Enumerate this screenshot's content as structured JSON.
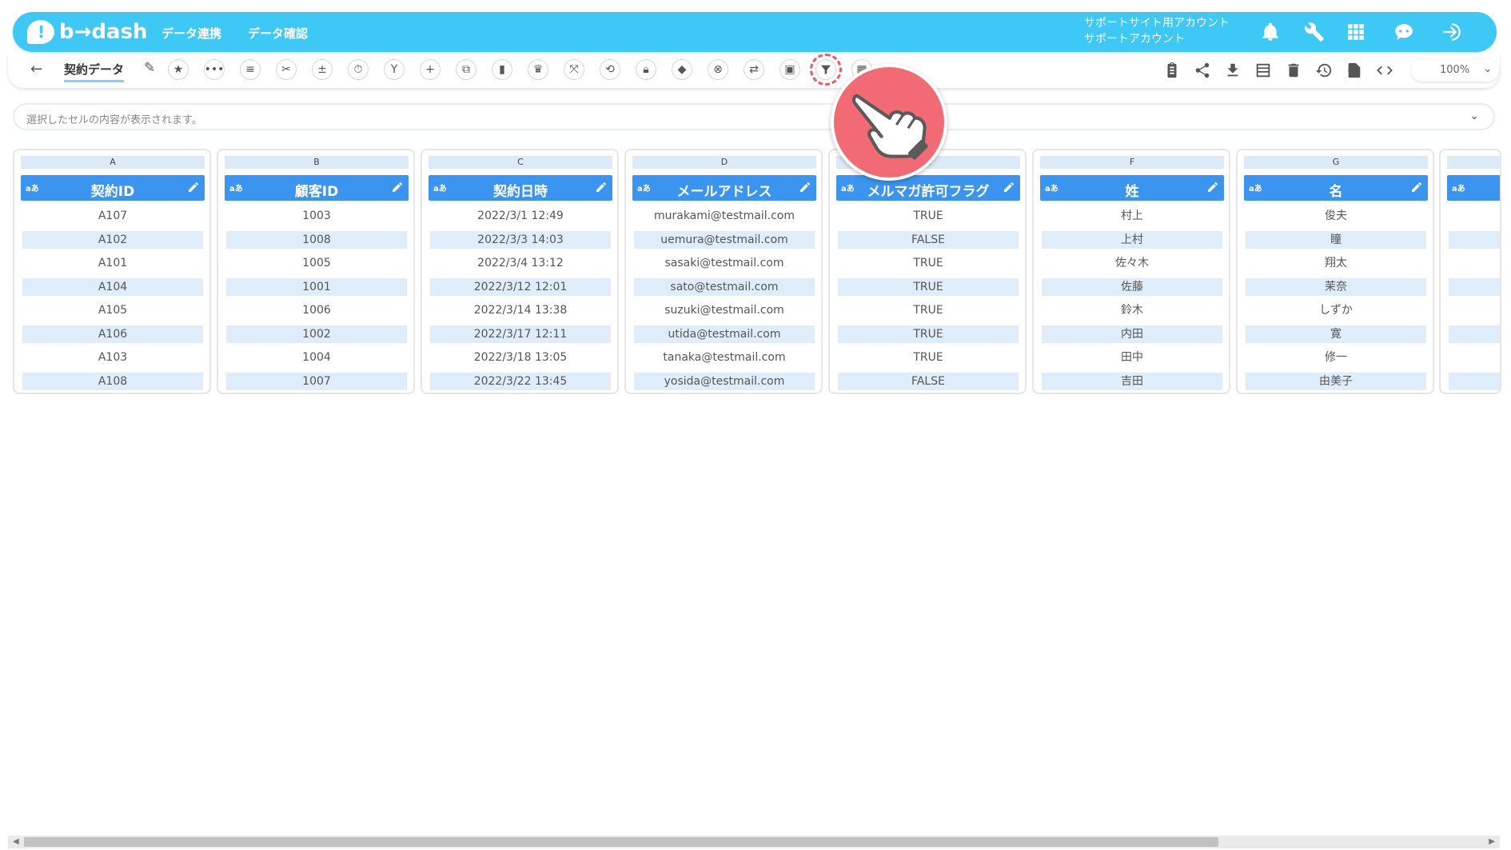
{
  "app": {
    "logo_text": "b→dash",
    "nav": [
      "データ連携",
      "データ確認"
    ],
    "account_line1": "サポートサイト用アカウント",
    "account_line2": "サポートアカウント"
  },
  "toolbar": {
    "dataset_name": "契約データ",
    "zoom": "100%",
    "highlighted_tool": "filter-icon"
  },
  "cellbar": {
    "placeholder": "選択したセルの内容が表示されます。"
  },
  "columns": [
    {
      "letter": "A",
      "type": "aあ",
      "name": "契約ID",
      "cells": [
        "A107",
        "A102",
        "A101",
        "A104",
        "A105",
        "A106",
        "A103",
        "A108"
      ]
    },
    {
      "letter": "B",
      "type": "aあ",
      "name": "顧客ID",
      "cells": [
        "1003",
        "1008",
        "1005",
        "1001",
        "1006",
        "1002",
        "1004",
        "1007"
      ]
    },
    {
      "letter": "C",
      "type": "aあ",
      "name": "契約日時",
      "cells": [
        "2022/3/1 12:49",
        "2022/3/3 14:03",
        "2022/3/4 13:12",
        "2022/3/12 12:01",
        "2022/3/14 13:38",
        "2022/3/17 12:11",
        "2022/3/18 13:05",
        "2022/3/22 13:45"
      ]
    },
    {
      "letter": "D",
      "type": "aあ",
      "name": "メールアドレス",
      "cells": [
        "murakami@testmail.com",
        "uemura@testmail.com",
        "sasaki@testmail.com",
        "sato@testmail.com",
        "suzuki@testmail.com",
        "utida@testmail.com",
        "tanaka@testmail.com",
        "yosida@testmail.com"
      ]
    },
    {
      "letter": "E",
      "type": "aあ",
      "name": "メルマガ許可フラグ",
      "cells": [
        "TRUE",
        "FALSE",
        "TRUE",
        "TRUE",
        "TRUE",
        "TRUE",
        "TRUE",
        "FALSE"
      ]
    },
    {
      "letter": "F",
      "type": "aあ",
      "name": "姓",
      "cells": [
        "村上",
        "上村",
        "佐々木",
        "佐藤",
        "鈴木",
        "内田",
        "田中",
        "吉田"
      ]
    },
    {
      "letter": "G",
      "type": "aあ",
      "name": "名",
      "cells": [
        "俊夫",
        "瞳",
        "翔太",
        "茉奈",
        "しずか",
        "寛",
        "修一",
        "由美子"
      ]
    },
    {
      "letter": "",
      "type": "aあ",
      "name": "契",
      "cells": [
        "",
        "",
        "",
        "",
        "",
        "",
        "",
        ""
      ]
    }
  ]
}
